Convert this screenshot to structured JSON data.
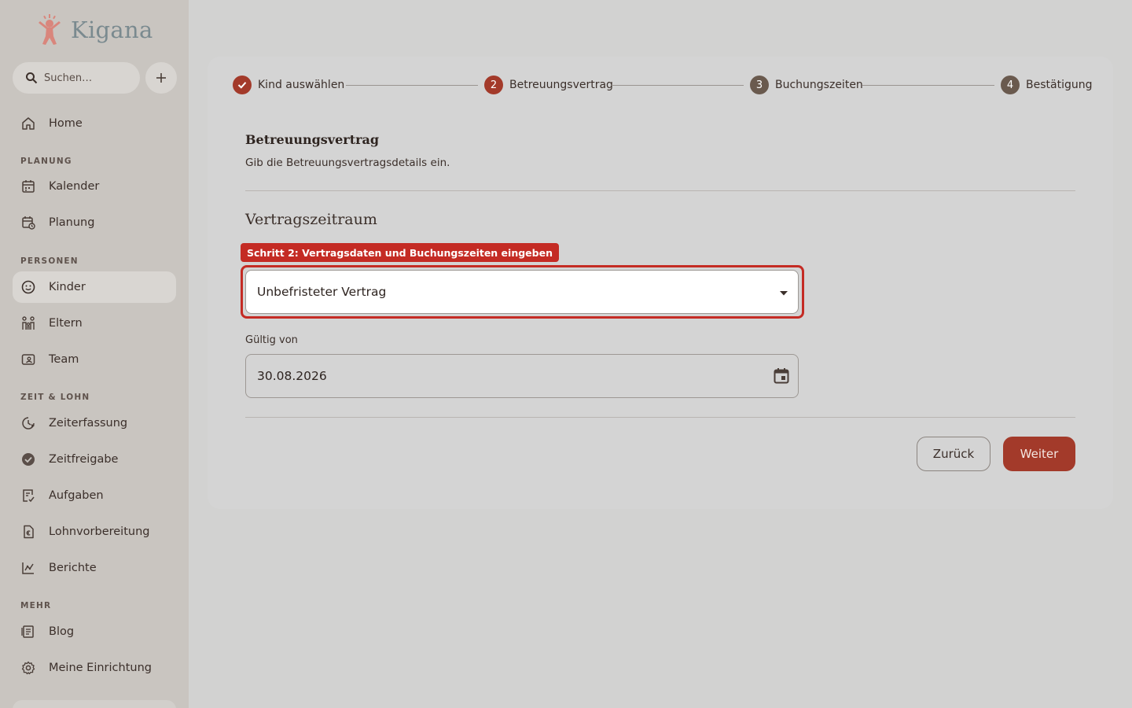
{
  "app": {
    "name": "Kigana"
  },
  "sidebar": {
    "search_placeholder": "Suchen…",
    "home": "Home",
    "sections": {
      "planung": "PLANUNG",
      "personen": "PERSONEN",
      "zeit_lohn": "ZEIT & LOHN",
      "mehr": "MEHR"
    },
    "items": {
      "kalender": "Kalender",
      "planung": "Planung",
      "kinder": "Kinder",
      "eltern": "Eltern",
      "team": "Team",
      "zeiterfassung": "Zeiterfassung",
      "zeitfreigabe": "Zeitfreigabe",
      "aufgaben": "Aufgaben",
      "lohnvorbereitung": "Lohnvorbereitung",
      "berichte": "Berichte",
      "blog": "Blog",
      "meine_einrichtung": "Meine Einrichtung"
    },
    "active_item": "Kinder"
  },
  "stepper": {
    "steps": [
      {
        "number": "1",
        "label": "Kind auswählen",
        "state": "done"
      },
      {
        "number": "2",
        "label": "Betreuungsvertrag",
        "state": "active"
      },
      {
        "number": "3",
        "label": "Buchungszeiten",
        "state": "pending"
      },
      {
        "number": "4",
        "label": "Bestätigung",
        "state": "pending"
      }
    ]
  },
  "form": {
    "title": "Betreuungsvertrag",
    "subtitle": "Gib die Betreuungsvertragsdetails ein.",
    "section_title": "Vertragszeitraum",
    "hint": "Schritt 2: Vertragsdaten und Buchungszeiten eingeben",
    "contract_type_value": "Unbefristeter Vertrag",
    "valid_from_label": "Gültig von",
    "valid_from_value": "30.08.2026",
    "back_label": "Zurück",
    "next_label": "Weiter"
  },
  "colors": {
    "accent": "#a33a2a",
    "highlight": "#c42b24",
    "sidebar_bg": "#c9c5c0",
    "page_bg": "#d2d2d1"
  }
}
